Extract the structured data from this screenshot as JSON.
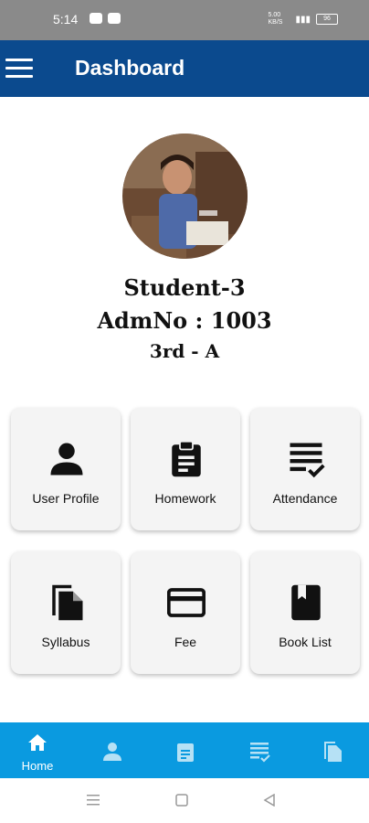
{
  "status_bar": {
    "time": "5:14",
    "net_speed": "5.00 KB/S",
    "battery": "96"
  },
  "app_bar": {
    "title": "Dashboard",
    "menu_icon": "menu-icon"
  },
  "profile": {
    "name": "Student-3",
    "adm_no": "AdmNo : 1003",
    "class_section": "3rd - A"
  },
  "tiles": [
    {
      "label": "User Profile",
      "icon": "person-icon"
    },
    {
      "label": "Homework",
      "icon": "clipboard-icon"
    },
    {
      "label": "Attendance",
      "icon": "checklist-icon"
    },
    {
      "label": "Syllabus",
      "icon": "file-copy-icon"
    },
    {
      "label": "Fee",
      "icon": "credit-card-icon"
    },
    {
      "label": "Book List",
      "icon": "book-icon"
    }
  ],
  "bottom_nav": {
    "active_label": "Home"
  },
  "colors": {
    "app_bar": "#0b4a8e",
    "bottom_nav": "#0a9ae0",
    "tile_bg": "#f4f4f4"
  }
}
